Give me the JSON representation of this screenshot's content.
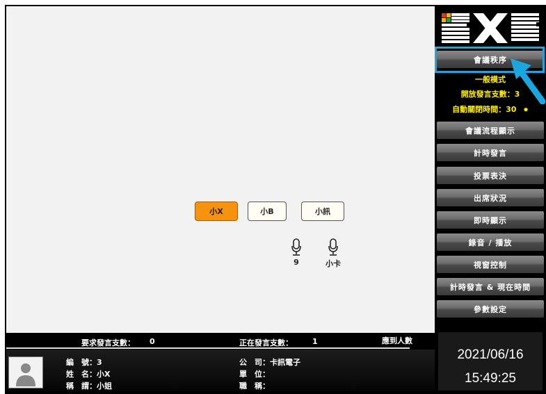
{
  "seats": [
    {
      "label": "小X",
      "active": true
    },
    {
      "label": "小B",
      "active": false
    },
    {
      "label": "小訊",
      "active": false
    }
  ],
  "mics": [
    {
      "label": "9"
    },
    {
      "label": "小卡"
    }
  ],
  "sidebar": {
    "logo": "BXB",
    "menu": [
      {
        "label": "會議秩序"
      },
      {
        "label": "會議流程顯示"
      },
      {
        "label": "計時發言"
      },
      {
        "label": "投票表決"
      },
      {
        "label": "出席狀況"
      },
      {
        "label": "即時顯示"
      },
      {
        "label": "錄音 / 播放"
      },
      {
        "label": "視窗控制"
      },
      {
        "label": "計時發言 & 現在時間"
      },
      {
        "label": "參數設定"
      }
    ],
    "mode": "一般模式",
    "open_count": "開放發言支數：3",
    "auto_close": "自動關閉時間：30"
  },
  "status": {
    "request_label": "要求發言支數：",
    "request_value": "0",
    "speaking_label": "正在發言支數：",
    "speaking_value": "1",
    "attendance_label": "應到人數"
  },
  "person": {
    "id_label": "編　號：",
    "id_value": "3",
    "name_label": "姓　名：",
    "name_value": "小X",
    "title_label": "稱　謂：",
    "title_value": "小姐",
    "company_label": "公　司：",
    "company_value": "卡訊電子",
    "unit_label": "單　位：",
    "unit_value": "",
    "position_label": "職　稱：",
    "position_value": ""
  },
  "clock": {
    "date": "2021/06/16",
    "time": "15:49:25"
  },
  "colors": {
    "accent": "#1aa7e0",
    "active_seat": "#f7920f",
    "info_text": "#ffee00"
  }
}
